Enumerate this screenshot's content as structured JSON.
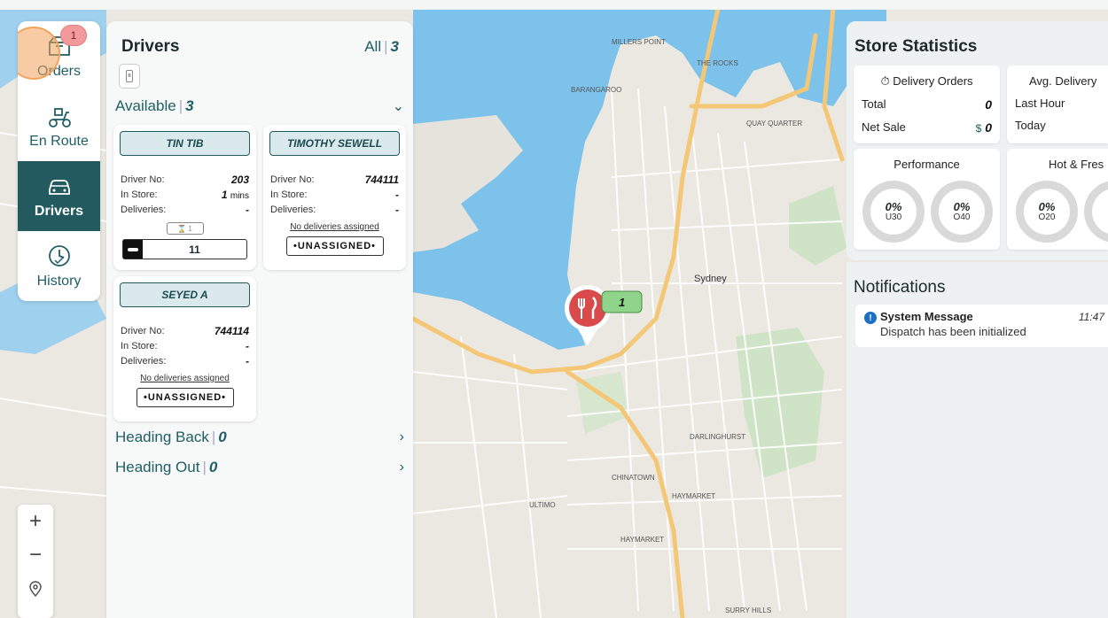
{
  "nav": {
    "items": [
      {
        "label": "Orders",
        "icon": "orders-icon",
        "badge": "1"
      },
      {
        "label": "En Route",
        "icon": "scooter-icon"
      },
      {
        "label": "Drivers",
        "icon": "car-icon"
      },
      {
        "label": "History",
        "icon": "history-icon"
      }
    ],
    "zoom_in": "+",
    "zoom_out": "−"
  },
  "drivers": {
    "title": "Drivers",
    "all_label": "All",
    "all_count": "3",
    "available_label": "Available",
    "available_count": "3",
    "heading_back_label": "Heading Back",
    "heading_back_count": "0",
    "heading_out_label": "Heading Out",
    "heading_out_count": "0",
    "labels": {
      "driver_no": "Driver No:",
      "in_store": "In Store:",
      "deliveries": "Deliveries:"
    },
    "cards": [
      {
        "name": "TIN TIB",
        "driver_no": "203",
        "in_store": "1",
        "in_store_unit": "mins",
        "deliveries": "-",
        "timer": "⌛ 1",
        "tracker": "11"
      },
      {
        "name": "TIMOTHY SEWELL",
        "driver_no": "744111",
        "in_store": "-",
        "deliveries": "-",
        "no_deliveries": "No deliveries assigned",
        "status": "•UNASSIGNED•"
      },
      {
        "name": "SEYED A",
        "driver_no": "744114",
        "in_store": "-",
        "deliveries": "-",
        "no_deliveries": "No deliveries assigned",
        "status": "•UNASSIGNED•"
      }
    ]
  },
  "map": {
    "labels": [
      "Sydney",
      "MILLERS POINT",
      "THE ROCKS",
      "BARANGAROO",
      "QUAY QUARTER",
      "CHINATOWN",
      "ULTIMO",
      "HAYMARKET",
      "HAYMARKET",
      "SURRY HILLS",
      "DARLINGHURST"
    ],
    "marker_count": "1",
    "colors": {
      "water": "#7cc2ea",
      "land": "#ebe8e1",
      "park": "#cfe3c6",
      "highway": "#f4c777"
    }
  },
  "stats": {
    "title": "Store Statistics",
    "delivery_orders": {
      "header": "Delivery Orders",
      "total_label": "Total",
      "total_value": "0",
      "net_sale_label": "Net Sale",
      "net_sale_currency": "$",
      "net_sale_value": "0"
    },
    "avg_delivery": {
      "header": "Avg. Delivery",
      "last_hour_label": "Last Hour",
      "today_label": "Today"
    },
    "performance": {
      "header": "Performance",
      "u30_value": "0%",
      "u30_label": "U30",
      "o40_value": "0%",
      "o40_label": "O40"
    },
    "hot_fresh": {
      "header": "Hot & Fres",
      "o20_value": "0%",
      "o20_label": "O20"
    }
  },
  "notifications": {
    "title": "Notifications",
    "items": [
      {
        "title": "System Message",
        "time": "11:47",
        "message": "Dispatch has been initialized"
      }
    ]
  }
}
